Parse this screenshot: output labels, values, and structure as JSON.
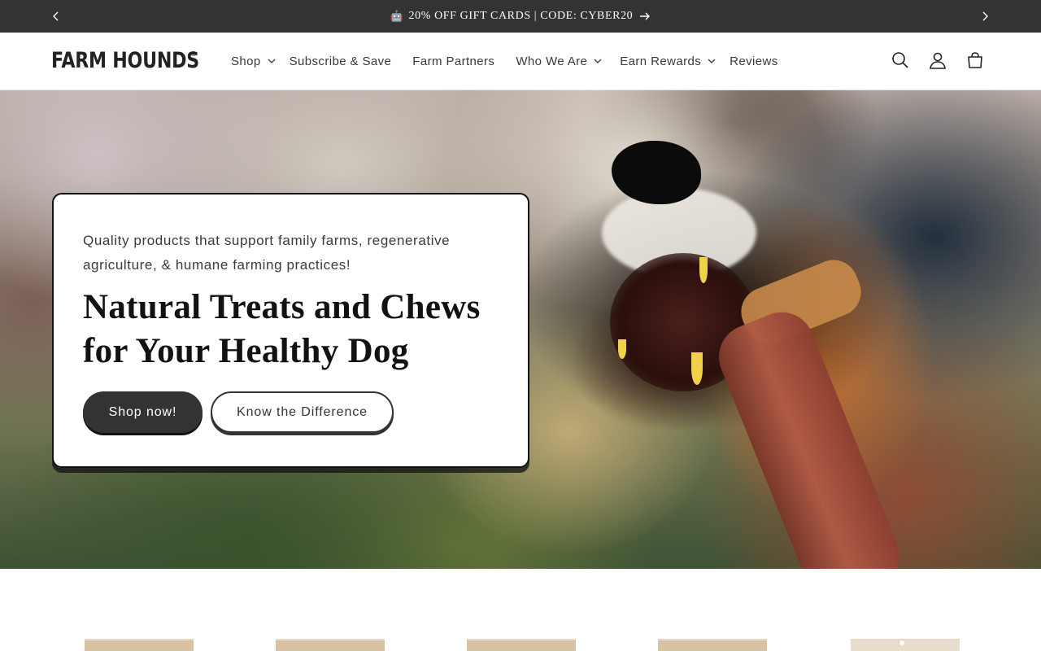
{
  "announcement": {
    "emoji": "🤖",
    "text": "20% OFF GIFT CARDS | CODE: CYBER20",
    "prev_icon": "chevron-left-icon",
    "next_icon": "chevron-right-icon",
    "go_icon": "arrow-right-icon"
  },
  "header": {
    "logo_text": "FARM HOUNDS",
    "logo_mark": "®",
    "nav": [
      {
        "label": "Shop",
        "dropdown": true
      },
      {
        "label": "Subscribe & Save",
        "dropdown": false
      },
      {
        "label": "Farm Partners",
        "dropdown": false
      },
      {
        "label": "Who We Are",
        "dropdown": true
      },
      {
        "label": "Earn Rewards",
        "dropdown": true
      },
      {
        "label": "Reviews",
        "dropdown": false
      }
    ],
    "icons": [
      "search-icon",
      "account-icon",
      "cart-icon"
    ]
  },
  "hero": {
    "subtitle": "Quality products that support family farms, regenerative agriculture, & humane farming practices!",
    "title": "Natural Treats and Chews for Your Healthy Dog",
    "primary_button": "Shop now!",
    "secondary_button": "Know the Difference"
  },
  "colors": {
    "announcement_bg": "#333333",
    "primary_button": "#333333",
    "text": "#121212"
  }
}
